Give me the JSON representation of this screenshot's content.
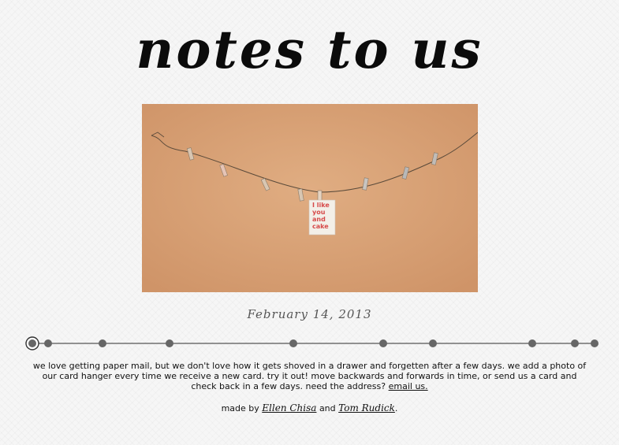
{
  "site": {
    "title": "notes to us"
  },
  "photo": {
    "date": "February 14, 2013",
    "card_text": [
      "I like",
      "you",
      "and",
      "cake"
    ],
    "colors": {
      "wall": "#d49c72",
      "card_red": "#d64a4a"
    }
  },
  "timeline": {
    "item_count": 11,
    "selected_index": 0,
    "colors": {
      "dot": "#666666",
      "line": "#555555"
    }
  },
  "intro": {
    "text": "we love getting paper mail, but we don't love how it gets shoved in a drawer and forgetten after a few days. we add a photo of our card hanger every time we receive a new card. try it out! move backwards and forwards in time, or send us a card and check back in a few days. need the address?",
    "link_label": "email us."
  },
  "credits": {
    "prefix": "made by",
    "author1": "Ellen Chisa",
    "joiner": "and",
    "author2": "Tom Rudick",
    "suffix": "."
  }
}
